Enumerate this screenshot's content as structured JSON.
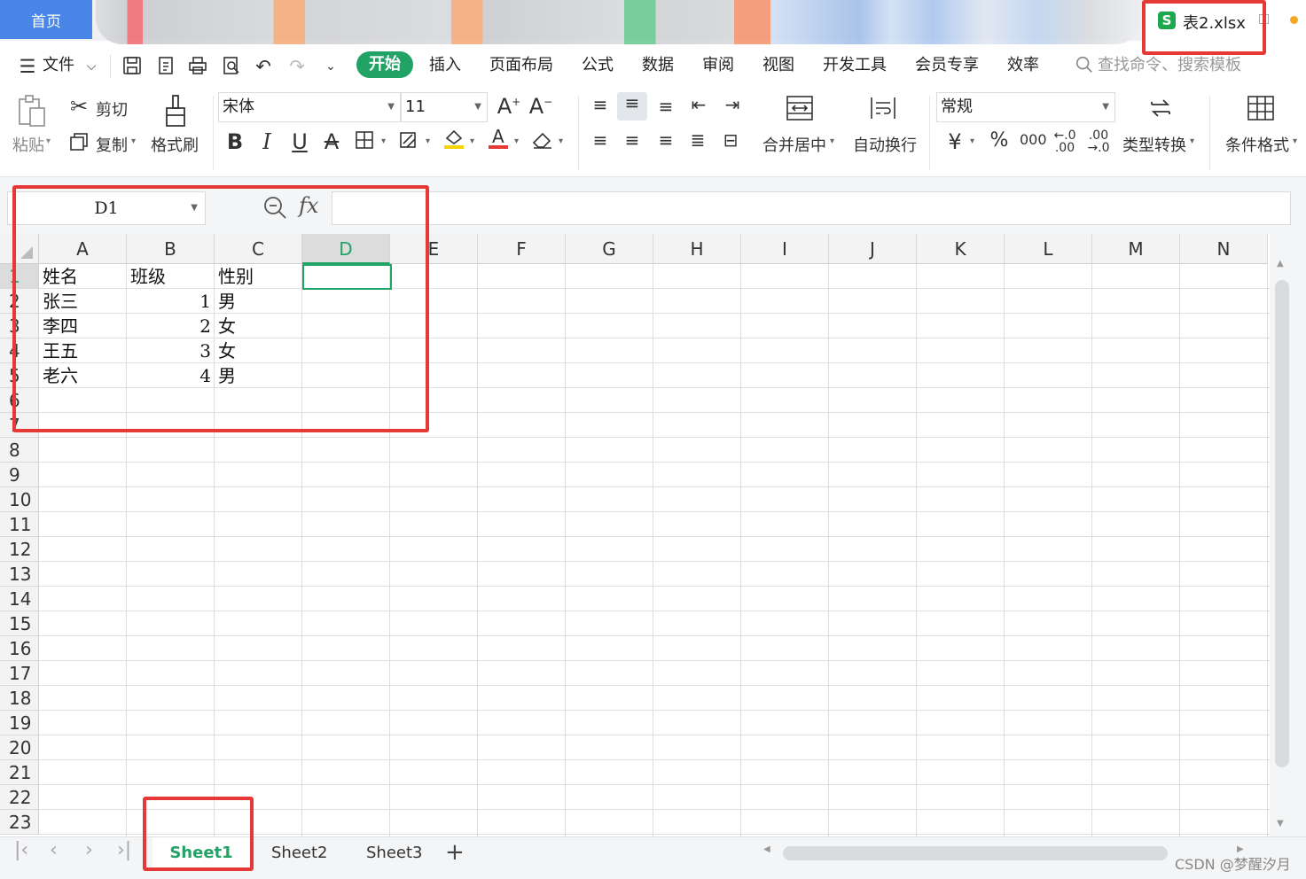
{
  "titlebar": {
    "home_tab": "首页",
    "file_name": "表2.xlsx",
    "file_icon_letter": "S"
  },
  "menu": {
    "file": "文件",
    "tabs": [
      "开始",
      "插入",
      "页面布局",
      "公式",
      "数据",
      "审阅",
      "视图",
      "开发工具",
      "会员专享",
      "效率"
    ],
    "active_tab": "开始",
    "search_placeholder": "查找命令、搜索模板"
  },
  "ribbon": {
    "paste": "粘贴",
    "cut": "剪切",
    "copy": "复制",
    "format_painter": "格式刷",
    "font_name": "宋体",
    "font_size": "11",
    "merge_center": "合并居中",
    "wrap_text": "自动换行",
    "number_format": "常规",
    "type_convert": "类型转换",
    "conditional_format": "条件格式",
    "currency_symbol": "¥",
    "percent_symbol": "%",
    "thousands_symbol": "000"
  },
  "formula_bar": {
    "name_box": "D1",
    "fx_label": "fx",
    "formula_value": ""
  },
  "grid": {
    "columns": [
      "A",
      "B",
      "C",
      "D",
      "E",
      "F",
      "G",
      "H",
      "I",
      "J",
      "K",
      "L",
      "M",
      "N"
    ],
    "rows": [
      "1",
      "2",
      "3",
      "4",
      "5",
      "6",
      "7",
      "8",
      "9",
      "10",
      "11",
      "12",
      "13",
      "14",
      "15",
      "16",
      "17",
      "18",
      "19",
      "20",
      "21",
      "22",
      "23"
    ],
    "selected_cell": "D1",
    "cells": [
      [
        "姓名",
        "班级",
        "性别"
      ],
      [
        "张三",
        "1",
        "男"
      ],
      [
        "李四",
        "2",
        "女"
      ],
      [
        "王五",
        "3",
        "女"
      ],
      [
        "老六",
        "4",
        "男"
      ]
    ]
  },
  "sheets": {
    "tabs": [
      "Sheet1",
      "Sheet2",
      "Sheet3"
    ],
    "active": "Sheet1"
  },
  "watermark": "CSDN @梦醒汐月",
  "colors": {
    "accent_green": "#21a366",
    "home_blue": "#4a86e8",
    "annotation_red": "#e53935"
  }
}
